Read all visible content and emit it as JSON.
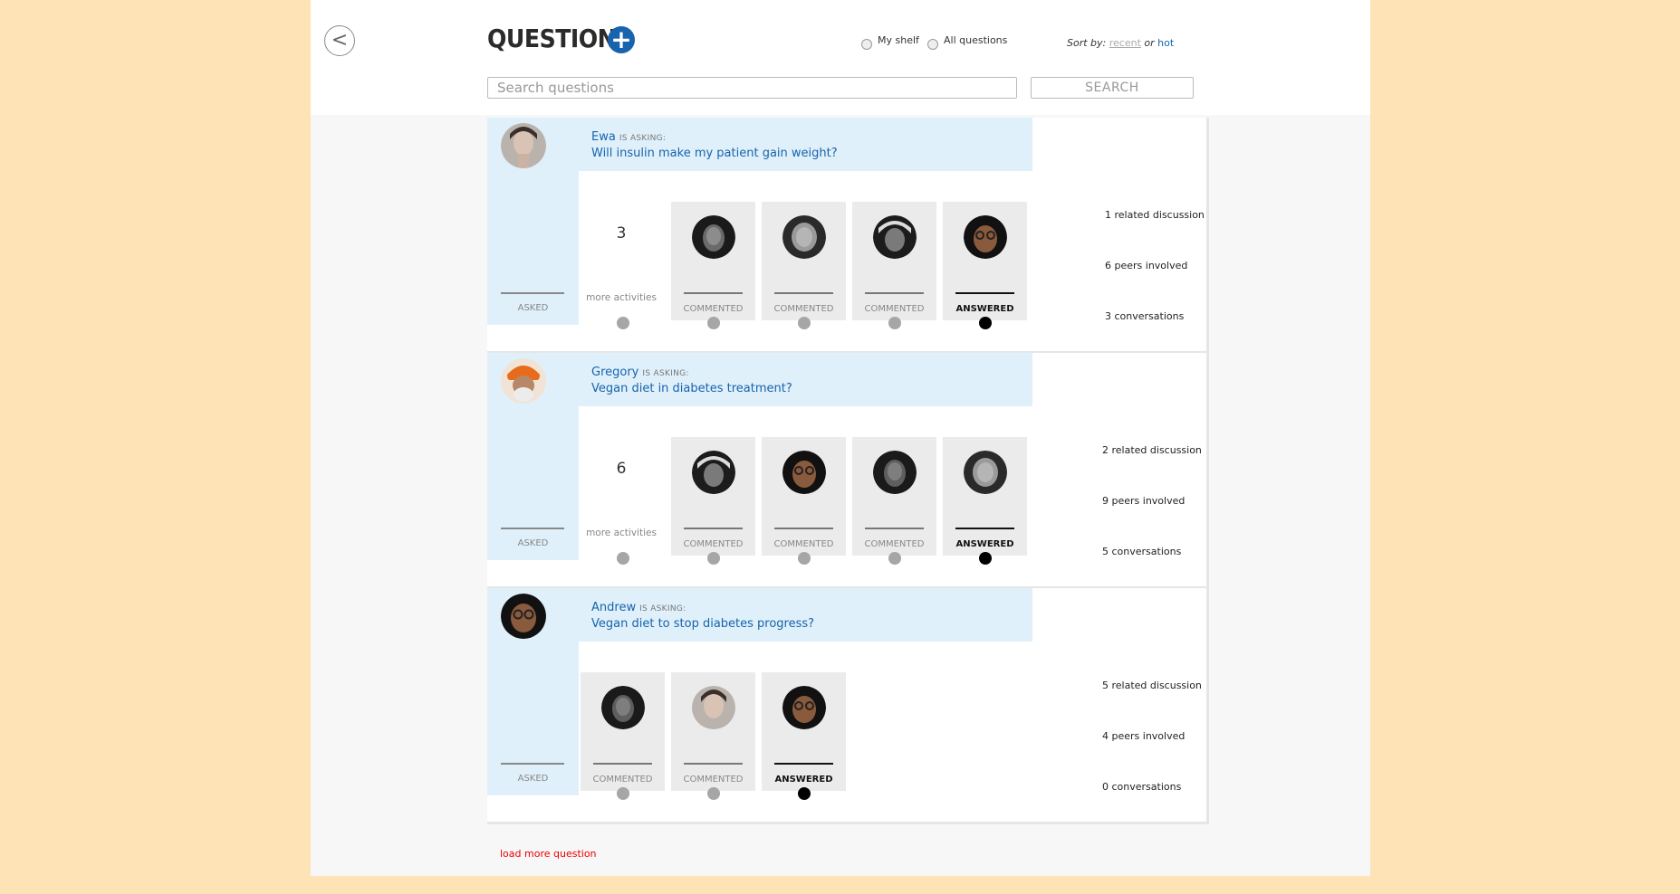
{
  "header": {
    "title": "QUESTION",
    "add_icon": "+",
    "back_icon": "<",
    "filters": [
      {
        "label": "My shelf",
        "selected": false
      },
      {
        "label": "All questions",
        "selected": false
      }
    ],
    "sort": {
      "prefix": "Sort by:",
      "option1": "recent",
      "joiner": "or",
      "option2": "hot"
    }
  },
  "search": {
    "placeholder": "Search questions",
    "button_label": "SEARCH"
  },
  "questions": [
    {
      "asker": "Ewa",
      "asking_label": "IS ASKING:",
      "text": "Will insulin make my patient gain weight?",
      "asked_label": "ASKED",
      "more_count": "3",
      "more_label": "more activities",
      "activities": [
        {
          "label": "COMMENTED",
          "type": "commented"
        },
        {
          "label": "COMMENTED",
          "type": "commented"
        },
        {
          "label": "COMMENTED",
          "type": "commented"
        },
        {
          "label": "ANSWERED",
          "type": "answered"
        }
      ],
      "stats": {
        "related": "1 related discussion",
        "peers": "6 peers involved",
        "conversations": "3 conversations"
      }
    },
    {
      "asker": "Gregory",
      "asking_label": "IS ASKING:",
      "text": "Vegan diet in diabetes treatment?",
      "asked_label": "ASKED",
      "more_count": "6",
      "more_label": "more activities",
      "activities": [
        {
          "label": "COMMENTED",
          "type": "commented"
        },
        {
          "label": "COMMENTED",
          "type": "commented"
        },
        {
          "label": "COMMENTED",
          "type": "commented"
        },
        {
          "label": "ANSWERED",
          "type": "answered"
        }
      ],
      "stats": {
        "related": "2 related discussion",
        "peers": "9 peers involved",
        "conversations": "5 conversations"
      }
    },
    {
      "asker": "Andrew",
      "asking_label": "IS ASKING:",
      "text": "Vegan diet to stop diabetes progress?",
      "asked_label": "ASKED",
      "activities": [
        {
          "label": "COMMENTED",
          "type": "commented"
        },
        {
          "label": "COMMENTED",
          "type": "commented"
        },
        {
          "label": "ANSWERED",
          "type": "answered"
        }
      ],
      "stats": {
        "related": "5 related discussion",
        "peers": "4 peers involved",
        "conversations": "0 conversations"
      }
    }
  ],
  "load_more": "load more question",
  "colors": {
    "accent": "#1763ad",
    "header_bg": "#dff0fa",
    "page_bg": "#fde3b6",
    "load_more": "#ee0000"
  }
}
